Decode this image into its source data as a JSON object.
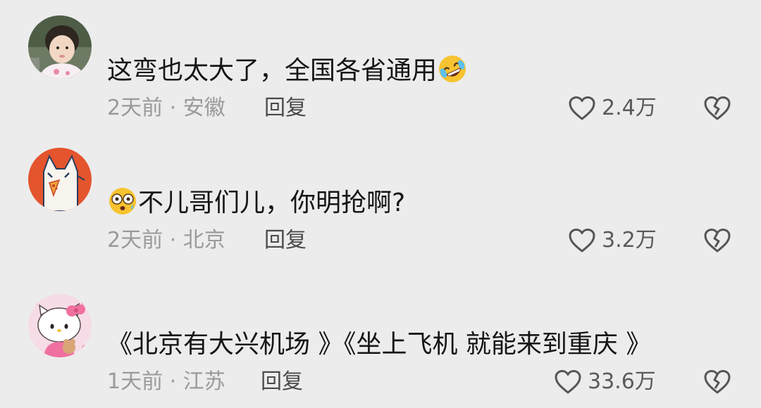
{
  "comments": [
    {
      "text": "这弯也太大了，全国各省通用",
      "emoji": "rolling-on-floor-laughing-emoji",
      "time": "2天前",
      "location": "安徽",
      "reply_label": "回复",
      "likes": "2.4万"
    },
    {
      "text": "不儿哥们儿，你明抢啊?",
      "emoji": "flushed-face-emoji",
      "time": "2天前",
      "location": "北京",
      "reply_label": "回复",
      "likes": "3.2万"
    },
    {
      "text": "《北京有大兴机场 》《坐上飞机 就能来到重庆 》",
      "time": "1天前",
      "location": "江苏",
      "reply_label": "回复",
      "likes": "33.6万"
    }
  ],
  "meta_separator": "·",
  "icons": {
    "like": "heart-outline-icon",
    "dislike": "broken-heart-icon"
  },
  "colors": {
    "background": "#ececec",
    "text": "#161616",
    "meta": "#9a9a9a",
    "icon": "#555555"
  }
}
